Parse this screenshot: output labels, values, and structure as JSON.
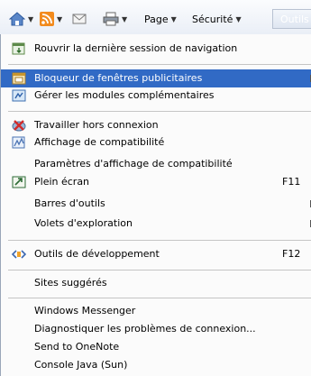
{
  "toolbar": {
    "page_label": "Page",
    "security_label": "Sécurité",
    "tools_label": "Outils",
    "dropdown_glyph": "▼"
  },
  "menu": {
    "reopen_session": "Rouvrir la dernière session de navigation",
    "popup_blocker": "Bloqueur de fenêtres publicitaires",
    "manage_addons": "Gérer les modules complémentaires",
    "work_offline": "Travailler hors connexion",
    "compat_view": "Affichage de compatibilité",
    "compat_settings": "Paramètres d'affichage de compatibilité",
    "fullscreen": "Plein écran",
    "fullscreen_shortcut": "F11",
    "toolbars": "Barres d'outils",
    "explorer_bars": "Volets d'exploration",
    "dev_tools": "Outils de développement",
    "dev_tools_shortcut": "F12",
    "suggested_sites": "Sites suggérés",
    "messenger": "Windows Messenger",
    "diagnose": "Diagnostiquer les problèmes de connexion...",
    "onenote": "Send to OneNote",
    "java_console": "Console Java (Sun)"
  },
  "colors": {
    "selection": "#316ac5",
    "menu_bg": "#fbfbfb",
    "separator": "#c5c5c5"
  }
}
